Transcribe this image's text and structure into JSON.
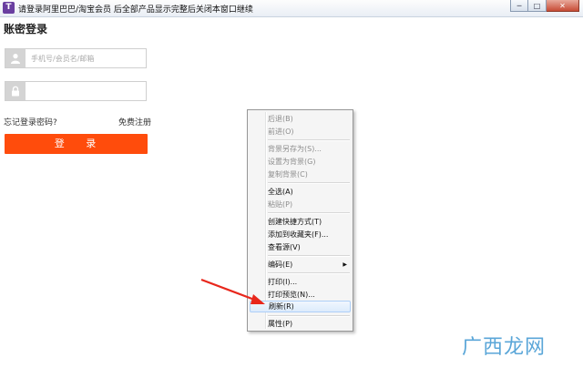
{
  "window": {
    "icon_glyph": "T",
    "title": "请登录阿里巴巴/淘宝会员 后全部产品显示完整后关闭本窗口继续",
    "controls": {
      "minimize": "─",
      "maximize": "□",
      "close": "✕"
    }
  },
  "login": {
    "title": "账密登录",
    "username_placeholder": "手机号/会员名/邮箱",
    "password_placeholder": "",
    "forgot_link": "忘记登录密码?",
    "register_link": "免费注册",
    "login_button": "登 录",
    "accent": "#ff4c0c"
  },
  "context_menu": {
    "items": [
      {
        "label": "后退(B)",
        "disabled": true
      },
      {
        "label": "前进(O)",
        "disabled": true
      },
      {
        "label": "背景另存为(S)...",
        "disabled": true
      },
      {
        "label": "设置为背景(G)",
        "disabled": true
      },
      {
        "label": "复制背景(C)",
        "disabled": true
      },
      {
        "label": "全选(A)",
        "disabled": false
      },
      {
        "label": "粘贴(P)",
        "disabled": true
      },
      {
        "label": "创建快捷方式(T)",
        "disabled": false
      },
      {
        "label": "添加到收藏夹(F)...",
        "disabled": false
      },
      {
        "label": "查看源(V)",
        "disabled": false
      },
      {
        "label": "编码(E)",
        "disabled": false,
        "submenu": true
      },
      {
        "label": "打印(I)...",
        "disabled": false
      },
      {
        "label": "打印预览(N)...",
        "disabled": false
      },
      {
        "label": "刷新(R)",
        "disabled": false,
        "highlighted": true
      },
      {
        "label": "属性(P)",
        "disabled": false
      }
    ]
  },
  "watermark": "广西龙网"
}
